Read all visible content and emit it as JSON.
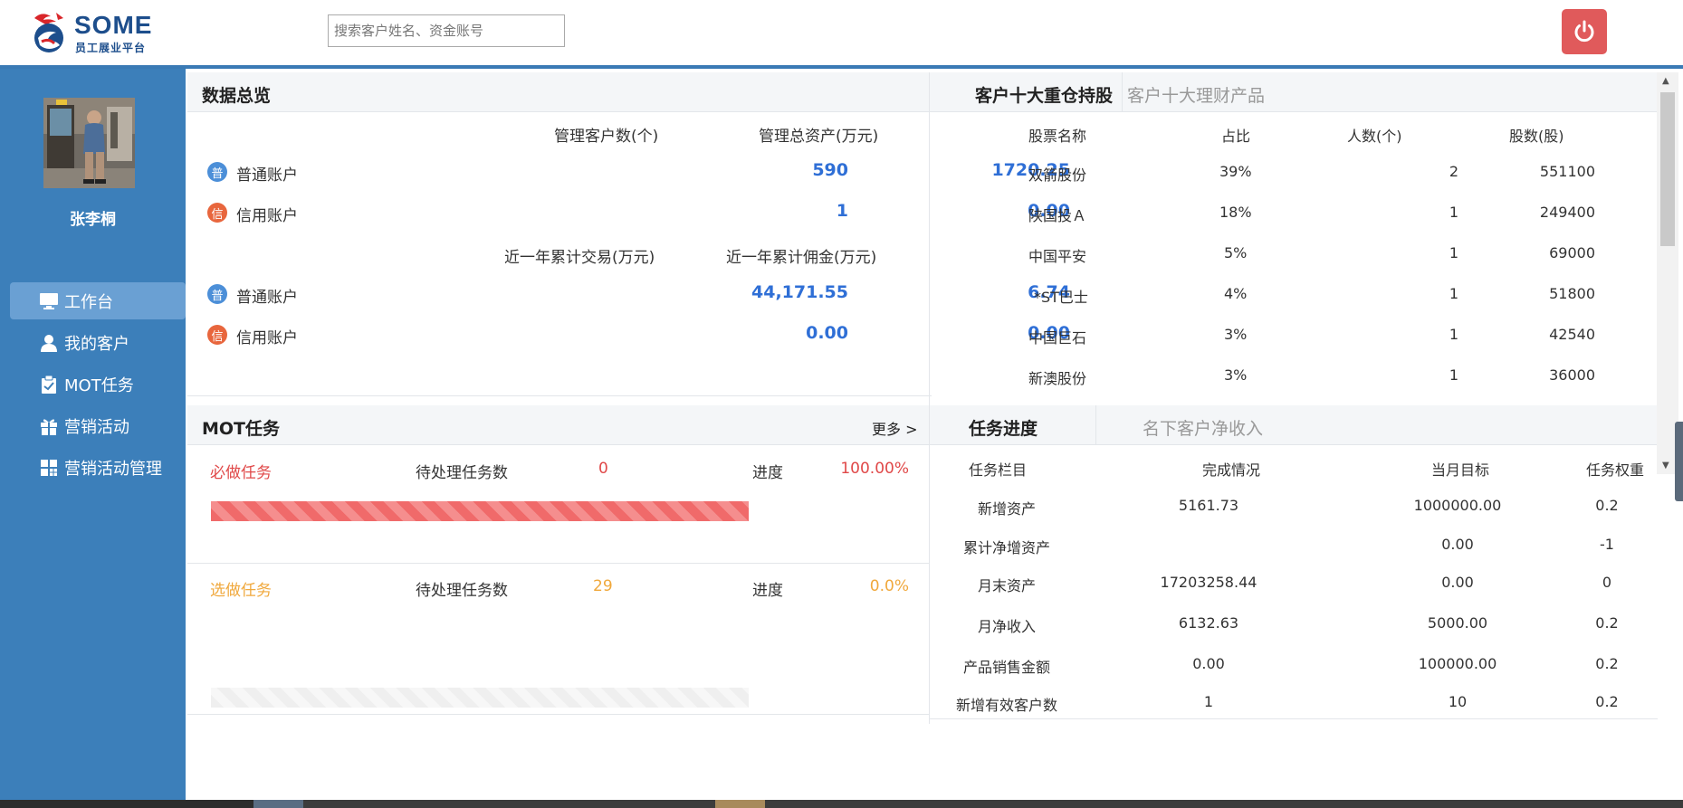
{
  "header": {
    "logo_title": "SOME",
    "logo_subtitle": "员工展业平台",
    "search_placeholder": "搜索客户姓名、资金账号",
    "power_icon": "power-icon"
  },
  "sidebar": {
    "user_name": "张李桐",
    "items": [
      {
        "label": "工作台",
        "icon": "monitor-icon",
        "active": true
      },
      {
        "label": "我的客户",
        "icon": "user-icon",
        "active": false
      },
      {
        "label": "MOT任务",
        "icon": "clipboard-icon",
        "active": false
      },
      {
        "label": "营销活动",
        "icon": "gift-icon",
        "active": false
      },
      {
        "label": "营销活动管理",
        "icon": "grid-icon",
        "active": false
      }
    ]
  },
  "overview": {
    "title": "数据总览",
    "col_customers": "管理客户数(个)",
    "col_assets": "管理总资产(万元)",
    "col_trade": "近一年累计交易(万元)",
    "col_commission": "近一年累计佣金(万元)",
    "badge_normal": "普",
    "badge_credit": "信",
    "normal_label": "普通账户",
    "credit_label": "信用账户",
    "normal_customers": "590",
    "normal_assets": "1720.25",
    "credit_customers": "1",
    "credit_assets": "0.00",
    "normal_trade": "44,171.55",
    "normal_commission": "6.74",
    "credit_trade": "0.00",
    "credit_commission": "0.00"
  },
  "holdings": {
    "tab_active": "客户十大重仓持股",
    "tab_inactive": "客户十大理财产品",
    "headers": [
      "股票名称",
      "占比",
      "人数(个)",
      "股数(股)"
    ],
    "rows": [
      {
        "name": "双箭股份",
        "ratio": "39%",
        "people": "2",
        "shares": "551100"
      },
      {
        "name": "陕国投Ａ",
        "ratio": "18%",
        "people": "1",
        "shares": "249400"
      },
      {
        "name": "中国平安",
        "ratio": "5%",
        "people": "1",
        "shares": "69000"
      },
      {
        "name": "*ST巴士",
        "ratio": "4%",
        "people": "1",
        "shares": "51800"
      },
      {
        "name": "中国巨石",
        "ratio": "3%",
        "people": "1",
        "shares": "42540"
      },
      {
        "name": "新澳股份",
        "ratio": "3%",
        "people": "1",
        "shares": "36000"
      }
    ]
  },
  "mot": {
    "title": "MOT任务",
    "more": "更多 >",
    "required": {
      "label": "必做任务",
      "pending_label": "待处理任务数",
      "pending": "0",
      "progress_label": "进度",
      "progress": "100.00%",
      "fill": 1.0
    },
    "optional": {
      "label": "选做任务",
      "pending_label": "待处理任务数",
      "pending": "29",
      "progress_label": "进度",
      "progress": "0.0%",
      "fill": 0.0
    }
  },
  "progress": {
    "tab_active": "任务进度",
    "tab_inactive": "名下客户净收入",
    "headers": [
      "任务栏目",
      "完成情况",
      "当月目标",
      "任务权重"
    ],
    "rows": [
      {
        "item": "新增资产",
        "done": "5161.73",
        "target": "1000000.00",
        "weight": "0.2"
      },
      {
        "item": "累计净增资产",
        "done": "",
        "target": "0.00",
        "weight": "-1"
      },
      {
        "item": "月末资产",
        "done": "17203258.44",
        "target": "0.00",
        "weight": "0"
      },
      {
        "item": "月净收入",
        "done": "6132.63",
        "target": "5000.00",
        "weight": "0.2"
      },
      {
        "item": "产品销售金额",
        "done": "0.00",
        "target": "100000.00",
        "weight": "0.2"
      },
      {
        "item": "新增有效客户数",
        "done": "1",
        "target": "10",
        "weight": "0.2"
      }
    ]
  },
  "colors": {
    "sidebar": "#3c7fba",
    "accent_blue": "#2f6fd6",
    "required_red": "#e04848",
    "optional_orange": "#f0a83c",
    "power_red": "#e05a5b"
  }
}
